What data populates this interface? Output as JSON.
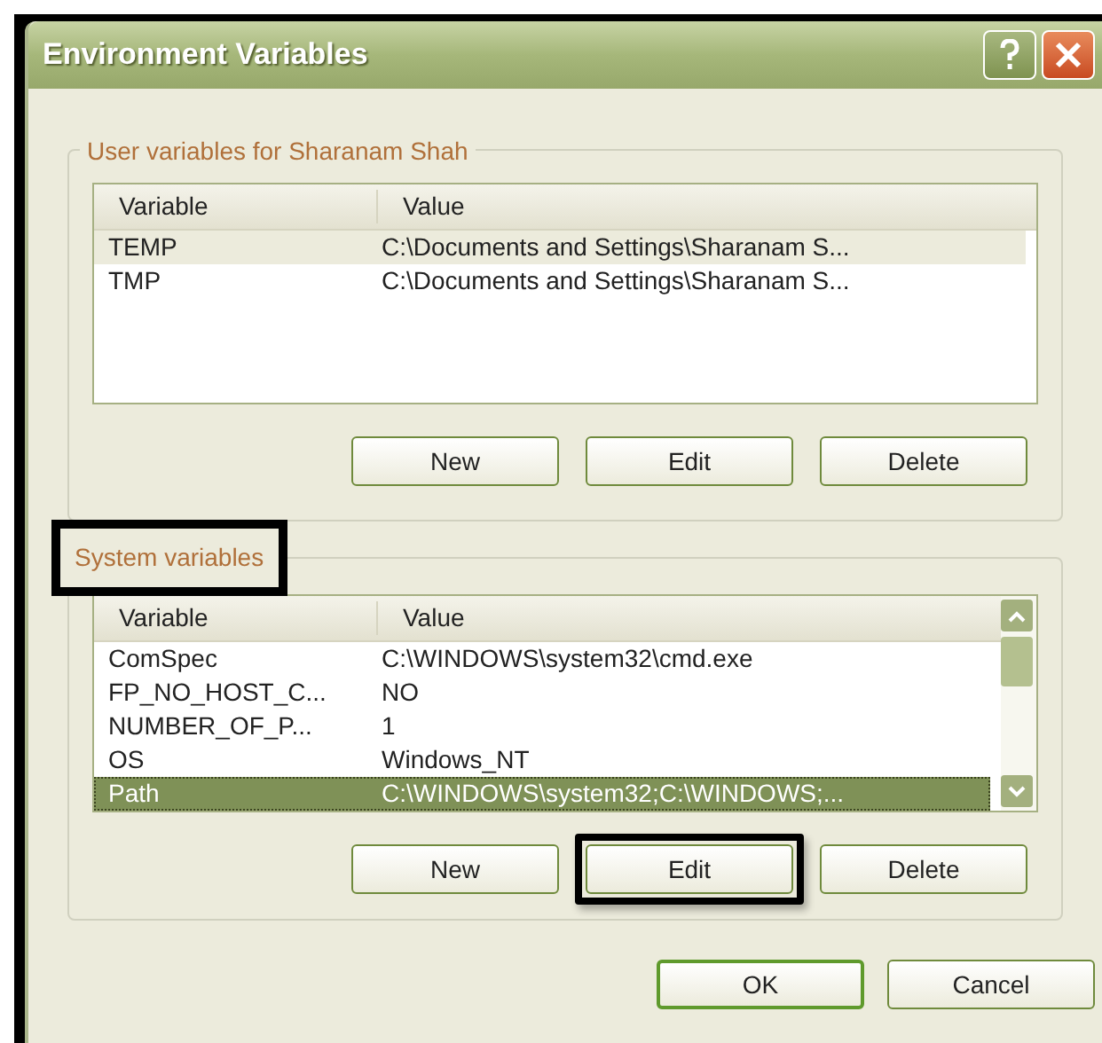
{
  "window": {
    "title": "Environment Variables"
  },
  "user_variables": {
    "label": "User variables for Sharanam Shah",
    "label_highlighted": false,
    "focused": false,
    "columns": [
      "Variable",
      "Value"
    ],
    "rows": [
      {
        "variable": "TEMP",
        "value": "C:\\Documents and Settings\\Sharanam S...",
        "selected": true
      },
      {
        "variable": "TMP",
        "value": "C:\\Documents and Settings\\Sharanam S...",
        "selected": false
      }
    ],
    "scrollbar": false,
    "buttons": [
      {
        "label": "New",
        "highlighted": false
      },
      {
        "label": "Edit",
        "highlighted": false
      },
      {
        "label": "Delete",
        "highlighted": false
      }
    ]
  },
  "system_variables": {
    "label": "System variables",
    "label_highlighted": true,
    "focused": true,
    "columns": [
      "Variable",
      "Value"
    ],
    "rows": [
      {
        "variable": "ComSpec",
        "value": "C:\\WINDOWS\\system32\\cmd.exe",
        "selected": false
      },
      {
        "variable": "FP_NO_HOST_C...",
        "value": "NO",
        "selected": false
      },
      {
        "variable": "NUMBER_OF_P...",
        "value": "1",
        "selected": false
      },
      {
        "variable": "OS",
        "value": "Windows_NT",
        "selected": false
      },
      {
        "variable": "Path",
        "value": "C:\\WINDOWS\\system32;C:\\WINDOWS;...",
        "selected": true
      }
    ],
    "scrollbar": true,
    "buttons": [
      {
        "label": "New",
        "highlighted": false
      },
      {
        "label": "Edit",
        "highlighted": true
      },
      {
        "label": "Delete",
        "highlighted": false
      }
    ]
  },
  "dialog_buttons": [
    {
      "label": "OK",
      "default": true
    },
    {
      "label": "Cancel",
      "default": false
    }
  ]
}
